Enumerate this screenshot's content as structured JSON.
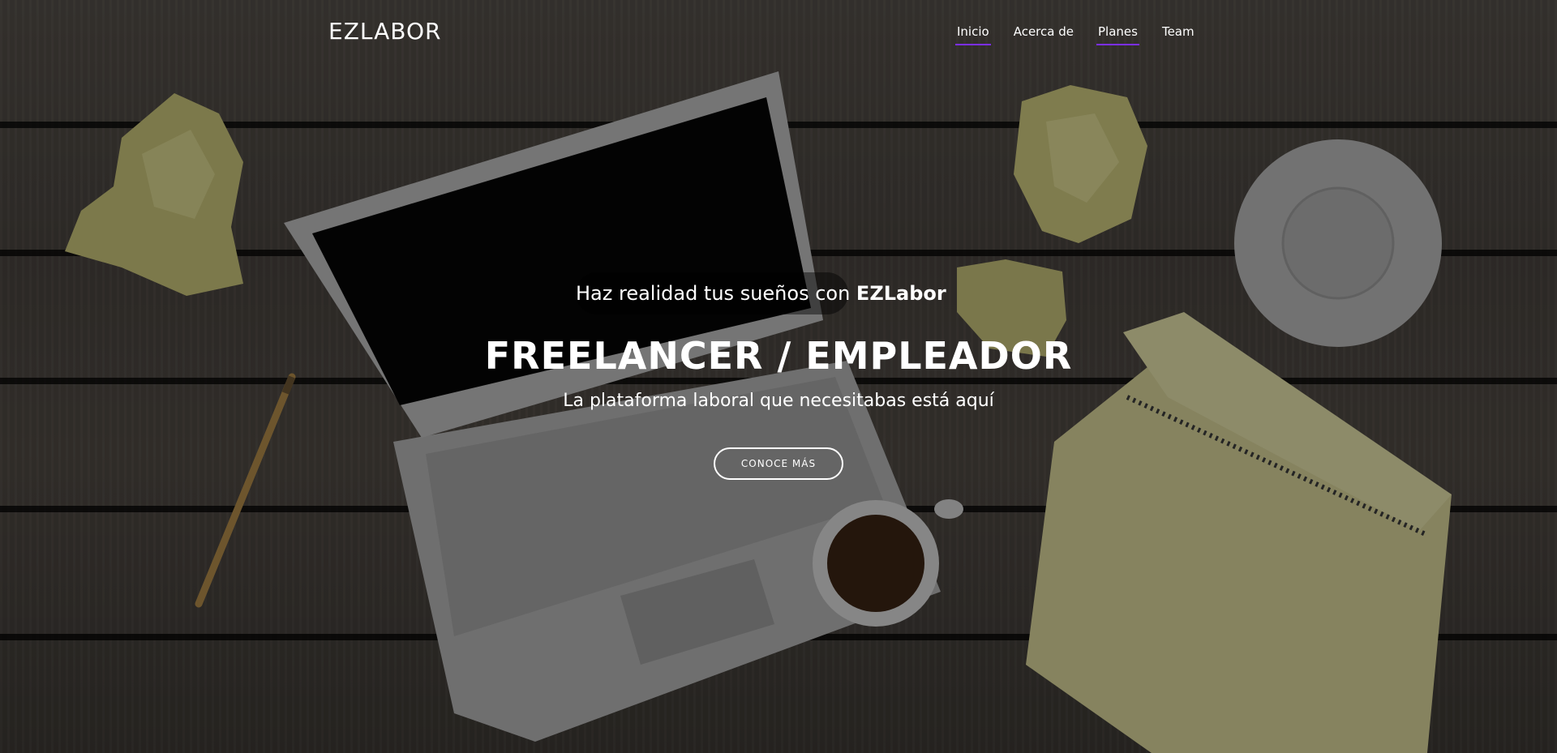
{
  "brand": {
    "name": "EZLABOR"
  },
  "nav": {
    "items": [
      {
        "label": "Inicio",
        "active": true
      },
      {
        "label": "Acerca de",
        "active": false
      },
      {
        "label": "Planes",
        "active": true
      },
      {
        "label": "Team",
        "active": false
      }
    ],
    "active_underline_color": "#7b2ff7"
  },
  "hero": {
    "tagline_prefix": "Haz realidad tus sueños con ",
    "tagline_brand": "EZLabor",
    "title": "FREELANCER / EMPLEADOR",
    "subtitle": "La plataforma laboral que necesitabas está aquí",
    "cta_label": "CONOCE MÁS"
  },
  "colors": {
    "text": "#ffffff",
    "overlay": "rgba(0,0,0,0.38)"
  }
}
